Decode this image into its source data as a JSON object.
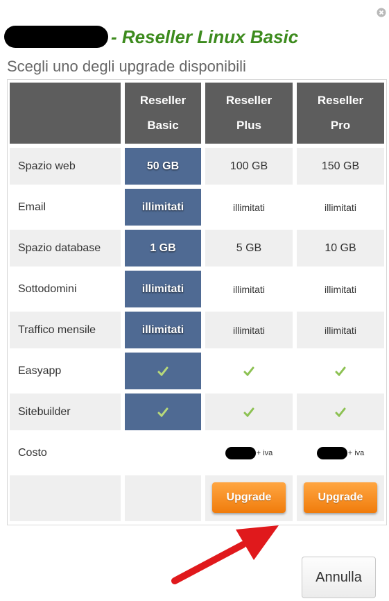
{
  "dialog": {
    "title": "- Reseller Linux Basic",
    "subtitle": "Scegli uno degli upgrade disponibili",
    "close_icon": "close-icon",
    "cancel_label": "Annulla"
  },
  "table": {
    "columns": [
      "Reseller Basic",
      "Reseller Plus",
      "Reseller Pro"
    ],
    "column_lines": [
      [
        "Reseller",
        "Basic"
      ],
      [
        "Reseller",
        "Plus"
      ],
      [
        "Reseller",
        "Pro"
      ]
    ],
    "rows": [
      {
        "label": "Spazio web",
        "values": [
          "50 GB",
          "100 GB",
          "150 GB"
        ]
      },
      {
        "label": "Email",
        "values": [
          "illimitati",
          "illimitati",
          "illimitati"
        ]
      },
      {
        "label": "Spazio database",
        "values": [
          "1 GB",
          "5 GB",
          "10 GB"
        ]
      },
      {
        "label": "Sottodomini",
        "values": [
          "illimitati",
          "illimitati",
          "illimitati"
        ]
      },
      {
        "label": "Traffico mensile",
        "values": [
          "illimitati",
          "illimitati",
          "illimitati"
        ]
      },
      {
        "label": "Easyapp",
        "values": [
          "check-icon",
          "check-icon",
          "check-icon"
        ]
      },
      {
        "label": "Sitebuilder",
        "values": [
          "check-icon",
          "check-icon",
          "check-icon"
        ]
      }
    ],
    "price_row": {
      "label": "Costo",
      "suffix": "+ iva"
    },
    "upgrade_label": "Upgrade"
  },
  "colors": {
    "title_green": "#3d8b1e",
    "header_gray": "#5d5d5d",
    "current_plan_blue": "#4f6a93",
    "upgrade_orange": "#f4891a",
    "arrow_red": "#e0191c"
  }
}
